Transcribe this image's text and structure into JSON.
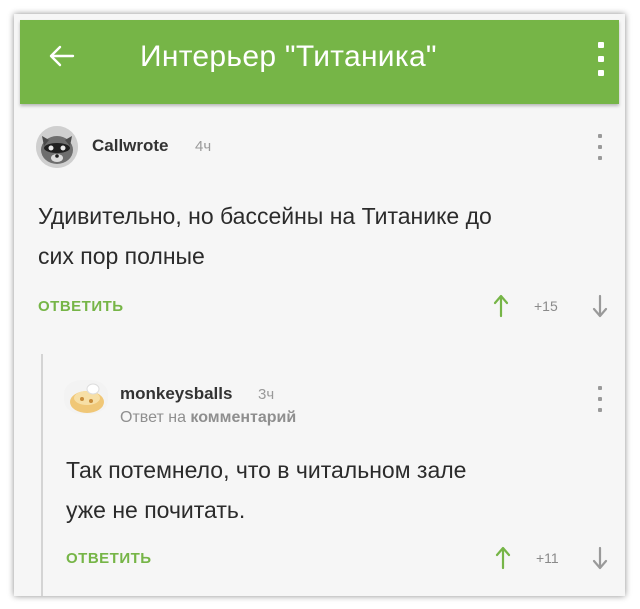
{
  "header": {
    "title": "Интерьер \"Титаника\"",
    "back_icon": "arrow-left-icon",
    "menu_icon": "more-vertical-icon",
    "bg_color": "#76b547"
  },
  "comments": [
    {
      "author": "Callwrote",
      "time": "4ч",
      "avatar_icon": "raccoon-avatar",
      "text_line1": "Удивительно, но бассейны на Титанике до",
      "text_line2": "сих пор полные",
      "reply_label": "ОТВЕТИТЬ",
      "score": "+15"
    },
    {
      "author": "monkeysballs",
      "time": "3ч",
      "avatar_icon": "food-avatar",
      "reply_to_prefix": "Ответ на",
      "reply_to_target": "комментарий",
      "text_line1": "Так потемнело, что в читальном зале",
      "text_line2": "уже не почитать.",
      "reply_label": "ОТВЕТИТЬ",
      "score": "+11"
    }
  ],
  "accent_color": "#76b547"
}
